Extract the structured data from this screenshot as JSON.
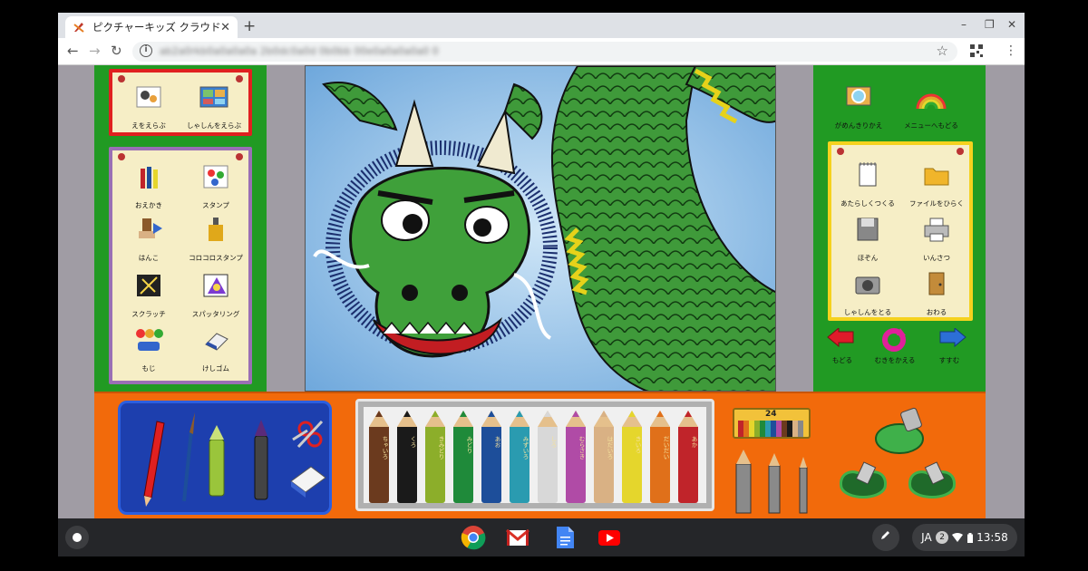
{
  "browser": {
    "tab_title": "ピクチャーキッズ クラウド",
    "tab_close": "✕",
    "new_tab": "+",
    "url": "ab2a0rkb0a0a0a0a 2b0dc0a0d 0b0bb 00e0a0a0a0a0 0",
    "window": {
      "minimize": "–",
      "restore": "❐",
      "close": "✕"
    },
    "nav": {
      "back": "←",
      "forward": "→",
      "reload": "↻"
    },
    "info": "i",
    "star": "☆",
    "menu": "⋮"
  },
  "app": {
    "mode_tools": [
      {
        "label": "えをえらぶ",
        "icon": "picture-select-icon"
      },
      {
        "label": "しゃしんをえらぶ",
        "icon": "photo-select-icon"
      }
    ],
    "draw_tools": [
      {
        "label": "おえかき",
        "icon": "crayons-icon"
      },
      {
        "label": "スタンプ",
        "icon": "stamp-icon"
      },
      {
        "label": "はんこ",
        "icon": "hanko-icon"
      },
      {
        "label": "コロコロスタンプ",
        "icon": "roller-stamp-icon"
      },
      {
        "label": "スクラッチ",
        "icon": "scratch-icon"
      },
      {
        "label": "スパッタリング",
        "icon": "spatter-icon"
      },
      {
        "label": "もじ",
        "icon": "text-icon"
      },
      {
        "label": "けしゴム",
        "icon": "eraser-icon"
      }
    ],
    "top_right": [
      {
        "label": "がめんきりかえ",
        "icon": "screen-switch-icon"
      },
      {
        "label": "メニューへもどる",
        "icon": "rainbow-menu-icon"
      }
    ],
    "file_tools": [
      {
        "label": "あたらしくつくる",
        "icon": "new-page-icon"
      },
      {
        "label": "ファイルをひらく",
        "icon": "folder-icon"
      },
      {
        "label": "ほぞん",
        "icon": "save-disk-icon"
      },
      {
        "label": "いんさつ",
        "icon": "printer-icon"
      },
      {
        "label": "しゃしんをとる",
        "icon": "camera-icon"
      },
      {
        "label": "おわる",
        "icon": "exit-door-icon"
      }
    ],
    "history": {
      "undo": "もどる",
      "rotate": "むきをかえる",
      "redo": "すすむ"
    },
    "crayon_count": "24",
    "crayons": [
      {
        "name": "ちゃいろ",
        "color": "#6b3a1e"
      },
      {
        "name": "くろ",
        "color": "#1a1a1a"
      },
      {
        "name": "きみどり",
        "color": "#8cae2a"
      },
      {
        "name": "みどり",
        "color": "#1f8a3a"
      },
      {
        "name": "あお",
        "color": "#1d4e9a"
      },
      {
        "name": "みずいろ",
        "color": "#2a9bb0"
      },
      {
        "name": "しろ",
        "color": "#d8d8d8"
      },
      {
        "name": "むらさき",
        "color": "#b04ba6"
      },
      {
        "name": "はだいろ",
        "color": "#d9b184"
      },
      {
        "name": "きいろ",
        "color": "#e5d62c"
      },
      {
        "name": "だいだい",
        "color": "#e0701a"
      },
      {
        "name": "あか",
        "color": "#c0242a"
      }
    ]
  },
  "shelf": {
    "ime": "JA",
    "notifications": "2",
    "time": "13:58",
    "apps": [
      "chrome-icon",
      "gmail-icon",
      "docs-icon",
      "youtube-icon"
    ]
  }
}
